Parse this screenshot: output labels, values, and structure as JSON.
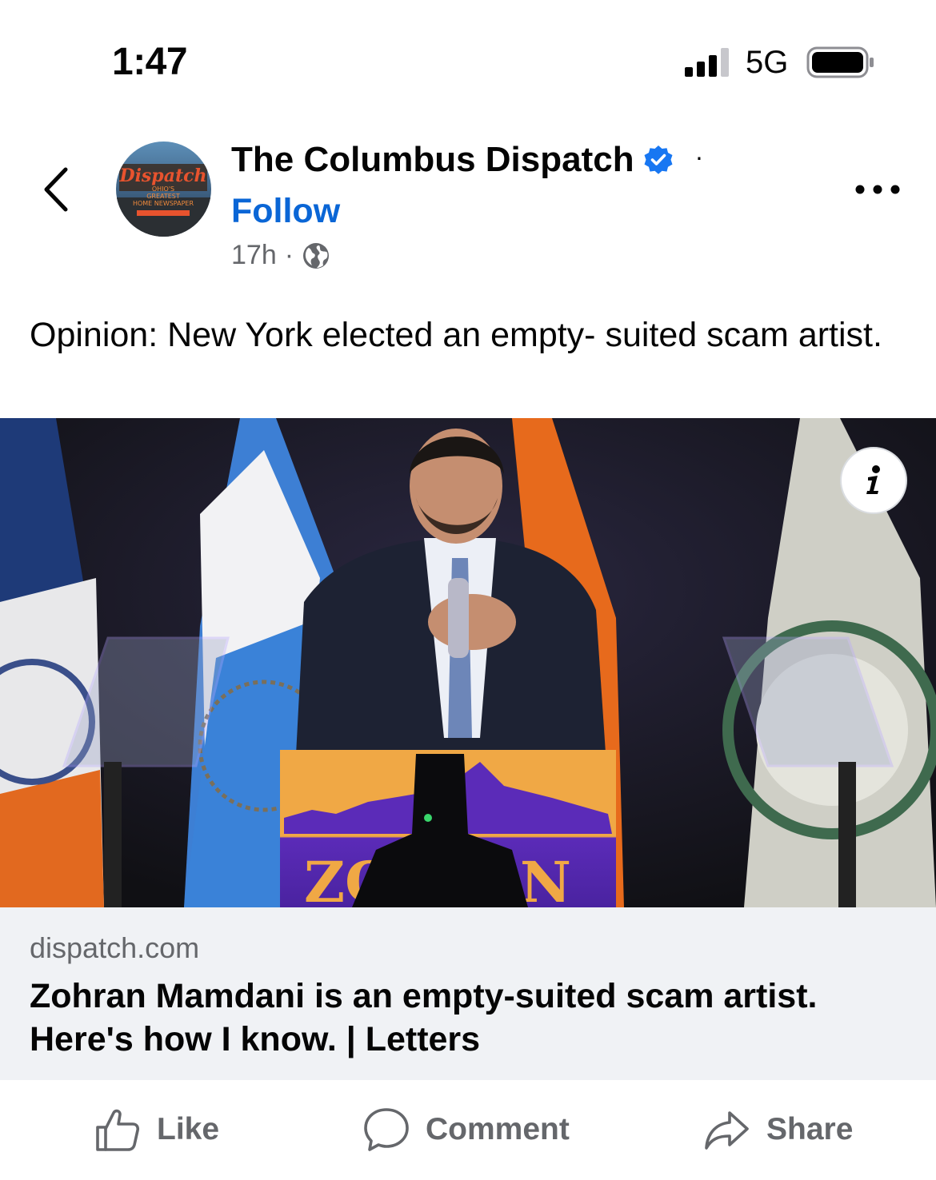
{
  "status_bar": {
    "time": "1:47",
    "network": "5G",
    "icons": [
      "signal-icon",
      "battery-icon"
    ]
  },
  "header": {
    "back_icon": "chevron-left-icon",
    "page_name": "The Columbus Dispatch",
    "verified_icon": "verified-badge-icon",
    "separator": "·",
    "follow_label": "Follow",
    "timestamp": "17h",
    "meta_separator": "·",
    "audience_icon": "globe-icon",
    "more_icon": "more-horizontal-icon",
    "avatar_logo_text": "Dispatch"
  },
  "post": {
    "caption": "Opinion: New York elected an empty- suited scam artist.",
    "photo_info_icon": "info-icon"
  },
  "link_preview": {
    "domain": "dispatch.com",
    "title": "Zohran Mamdani is an empty-suited scam artist. Here's how I know. | Letters"
  },
  "actions": {
    "like_label": "Like",
    "comment_label": "Comment",
    "share_label": "Share"
  },
  "colors": {
    "link_blue": "#0a66d6",
    "verified_blue": "#1877f2",
    "muted_text": "#65676b",
    "preview_bg": "#f0f2f5"
  }
}
